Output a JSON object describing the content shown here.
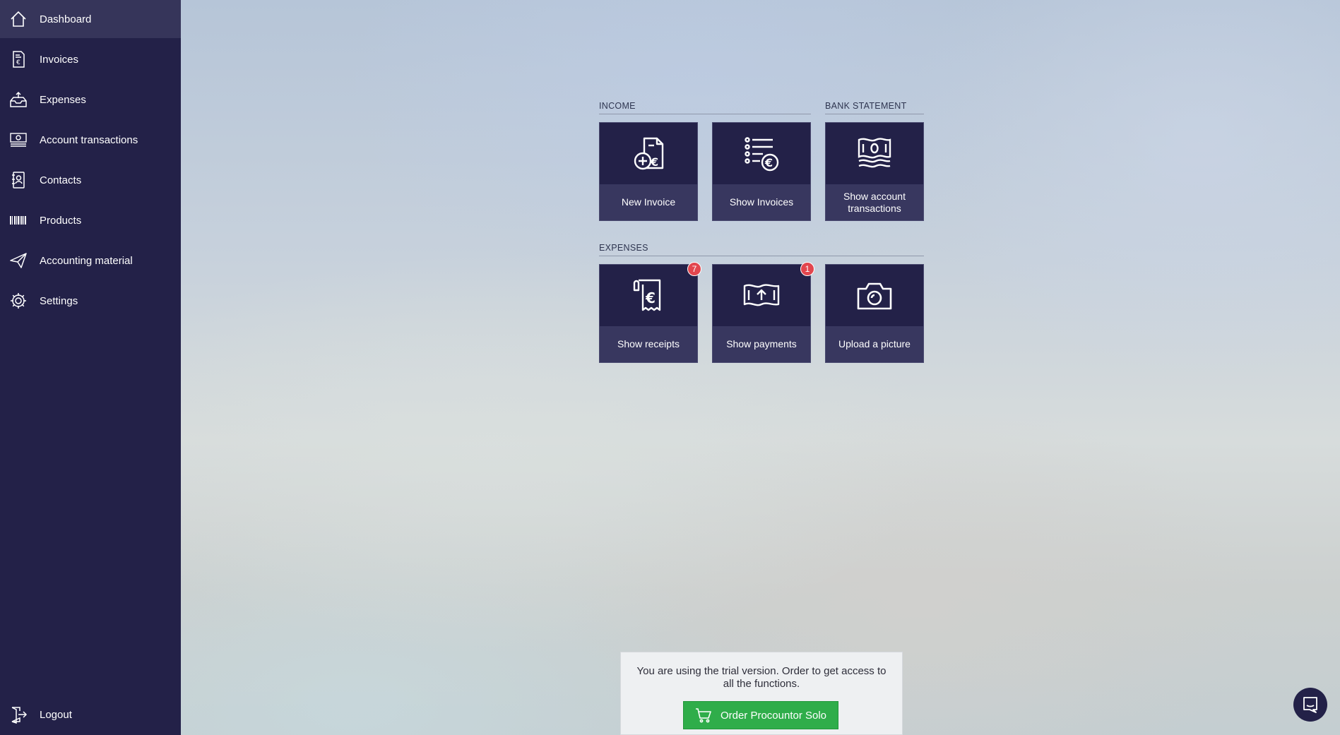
{
  "sidebar": {
    "items": [
      {
        "label": "Dashboard",
        "icon": "home-icon",
        "active": true
      },
      {
        "label": "Invoices",
        "icon": "invoice-icon"
      },
      {
        "label": "Expenses",
        "icon": "inbox-icon"
      },
      {
        "label": "Account transactions",
        "icon": "banknote-icon"
      },
      {
        "label": "Contacts",
        "icon": "contacts-book-icon"
      },
      {
        "label": "Products",
        "icon": "barcode-icon"
      },
      {
        "label": "Accounting material",
        "icon": "send-icon"
      },
      {
        "label": "Settings",
        "icon": "gear-icon"
      }
    ],
    "logout": {
      "label": "Logout",
      "icon": "logout-icon"
    }
  },
  "income": {
    "title": "INCOME",
    "tiles": [
      {
        "label": "New Invoice",
        "icon": "new-invoice-icon"
      },
      {
        "label": "Show Invoices",
        "icon": "invoice-list-icon"
      }
    ]
  },
  "bank_statement": {
    "title": "BANK STATEMENT",
    "tiles": [
      {
        "label": "Show account transactions",
        "icon": "banknotes-icon"
      }
    ]
  },
  "expenses": {
    "title": "EXPENSES",
    "tiles": [
      {
        "label": "Show receipts",
        "icon": "receipt-icon",
        "badge": "7"
      },
      {
        "label": "Show payments",
        "icon": "payment-upload-icon",
        "badge": "1"
      },
      {
        "label": "Upload a picture",
        "icon": "camera-icon"
      }
    ]
  },
  "trial": {
    "text": "You are using the trial version. Order to get access to all the functions.",
    "button_label": "Order Procountor Solo",
    "button_icon": "cart-icon"
  },
  "chat": {
    "icon": "chat-icon"
  },
  "colors": {
    "sidebar_bg": "#232148",
    "sidebar_active": "#36355a",
    "tile_bg": "#232148",
    "tile_label_bg": "#38375f",
    "badge": "#e2464e",
    "order_button": "#2fad4a"
  }
}
